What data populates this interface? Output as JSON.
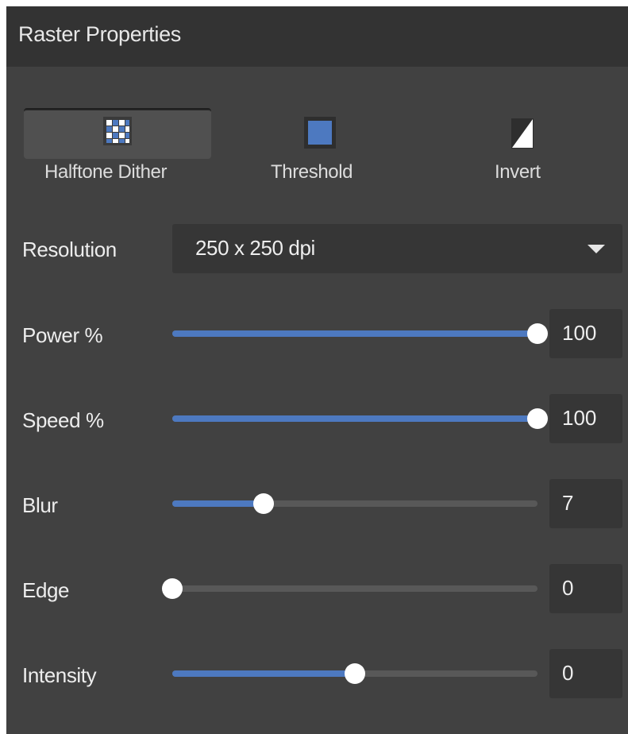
{
  "panel": {
    "title": "Raster Properties"
  },
  "modes": [
    {
      "label": "Halftone Dither",
      "icon": "halftone-grid-icon",
      "active": true
    },
    {
      "label": "Threshold",
      "icon": "threshold-square-icon",
      "active": false
    },
    {
      "label": "Invert",
      "icon": "invert-triangle-icon",
      "active": false
    }
  ],
  "resolution": {
    "label": "Resolution",
    "value": "250 x 250 dpi"
  },
  "sliders": [
    {
      "label": "Power %",
      "value": "100",
      "fraction": 1.0
    },
    {
      "label": "Speed %",
      "value": "100",
      "fraction": 1.0
    },
    {
      "label": "Blur",
      "value": "7",
      "fraction": 0.25
    },
    {
      "label": "Edge",
      "value": "0",
      "fraction": 0.0
    },
    {
      "label": "Intensity",
      "value": "0",
      "fraction": 0.5
    }
  ],
  "colors": {
    "accent": "#4d79c0",
    "panel": "#414141",
    "header": "#333333"
  }
}
